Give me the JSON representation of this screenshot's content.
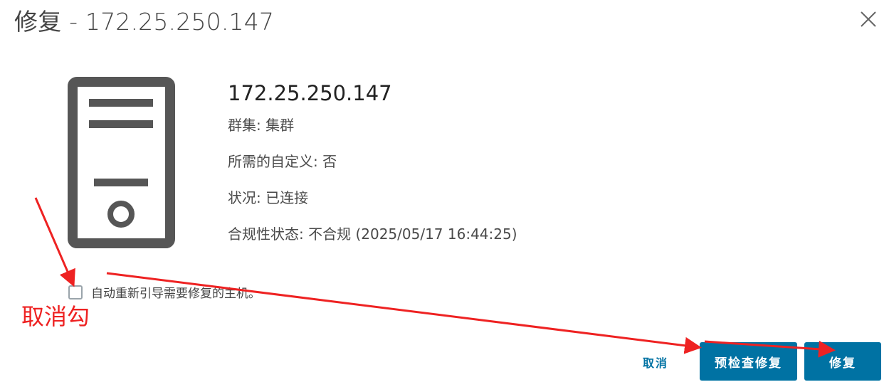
{
  "dialog": {
    "title": "修复 - 172.25.250.147",
    "close_icon": "close-x-icon"
  },
  "host": {
    "icon": "server-host-icon",
    "name": "172.25.250.147",
    "rows": [
      "群集: 集群",
      "所需的自定义: 否",
      "状况: 已连接",
      "合规性状态: 不合规 (2025/05/17 16:44:25)"
    ]
  },
  "options": {
    "auto_reboot_label": "自动重新引导需要修复的主机。",
    "auto_reboot_checked": false
  },
  "annotation": {
    "text": "取消勾",
    "color": "#ee2222"
  },
  "footer": {
    "cancel_label": "取消",
    "precheck_label": "预检查修复",
    "remediate_label": "修复"
  },
  "colors": {
    "primary": "#0072a3",
    "icon": "#565656",
    "annotation": "#ee2222"
  }
}
